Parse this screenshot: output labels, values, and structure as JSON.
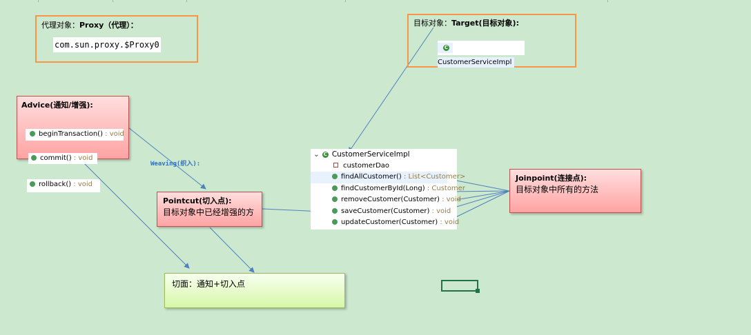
{
  "proxy": {
    "title_cn": "代理对象：",
    "title_en": "Proxy（代理）：",
    "class_name": "com.sun.proxy.$Proxy0"
  },
  "target": {
    "title_cn": "目标对象：",
    "title_en": "Target(目标对象):",
    "class_name": "CustomerServiceImpl"
  },
  "advice": {
    "title": "Advice(通知/增强):",
    "methods": [
      {
        "name": "beginTransaction()",
        "ret": " : void"
      },
      {
        "name": "commit()",
        "ret": " : void"
      },
      {
        "name": "rollback()",
        "ret": " : void"
      }
    ]
  },
  "weaving": {
    "label": "Weaving(织入):"
  },
  "pointcut": {
    "title": "Pointcut(切入点):",
    "desc": "目标对象中已经增强的方"
  },
  "aspect": {
    "text": "切面：通知+切入点"
  },
  "joinpoint": {
    "title": "Joinpoint(连接点):",
    "desc": "目标对象中所有的方法"
  },
  "class_tree": {
    "class_name": "CustomerServiceImpl",
    "field": "customerDao",
    "methods": [
      {
        "name": "findAllCustomer()",
        "ret": " : List<Customer>"
      },
      {
        "name": "findCustomerById(Long)",
        "ret": " : Customer"
      },
      {
        "name": "removeCustomer(Customer)",
        "ret": " : void"
      },
      {
        "name": "saveCustomer(Customer)",
        "ret": " : void"
      },
      {
        "name": "updateCustomer(Customer)",
        "ret": " : void"
      }
    ]
  },
  "colors": {
    "background": "#cce8cf",
    "box_border": "#f79646",
    "arrow": "#4f81bd",
    "selection": "#217346"
  }
}
